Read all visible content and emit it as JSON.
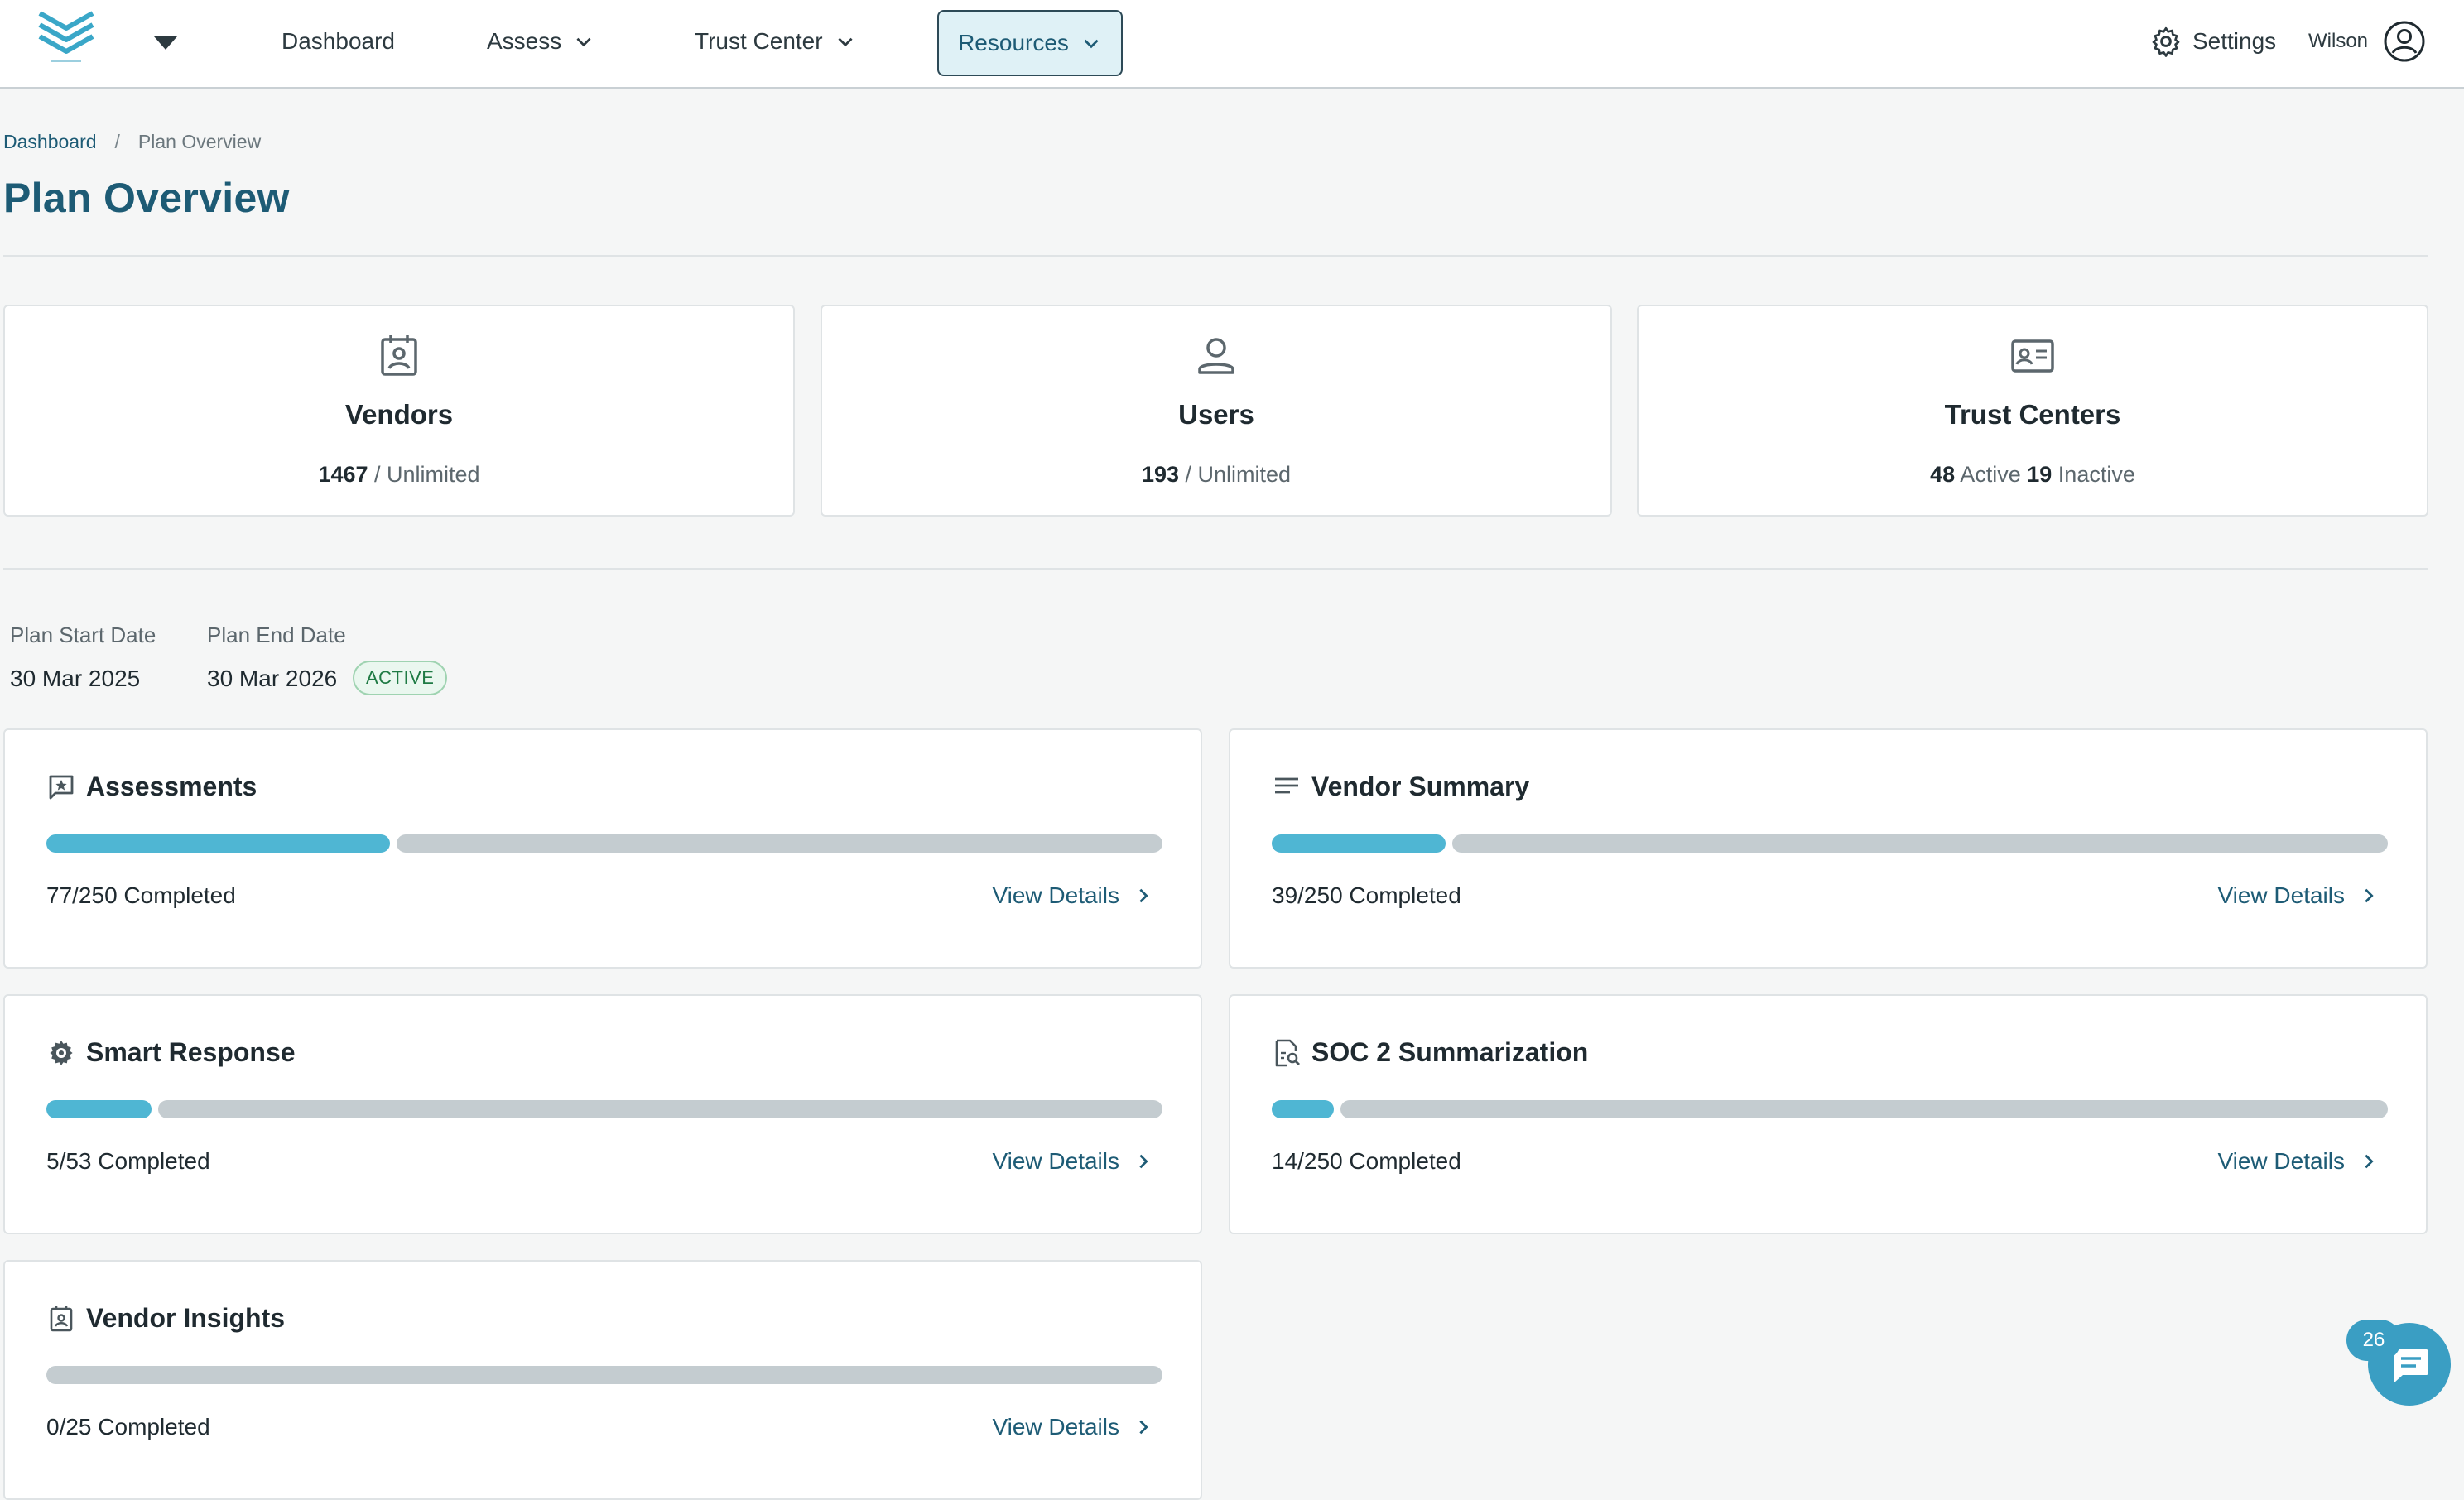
{
  "nav": {
    "items": [
      {
        "label": "Dashboard"
      },
      {
        "label": "Assess"
      },
      {
        "label": "Trust Center"
      },
      {
        "label": "Resources"
      }
    ],
    "settings_label": "Settings",
    "user_name": "Wilson"
  },
  "breadcrumb": {
    "home": "Dashboard",
    "separator": "/",
    "current": "Plan Overview"
  },
  "page_title": "Plan Overview",
  "stats": {
    "vendors": {
      "title": "Vendors",
      "count": "1467",
      "suffix": "/ Unlimited"
    },
    "users": {
      "title": "Users",
      "count": "193",
      "suffix": "/ Unlimited"
    },
    "trust_centers": {
      "title": "Trust Centers",
      "active_count": "48",
      "active_label": "Active",
      "inactive_count": "19",
      "inactive_label": "Inactive"
    }
  },
  "plan": {
    "start_label": "Plan Start Date",
    "start_value": "30 Mar 2025",
    "end_label": "Plan End Date",
    "end_value": "30 Mar 2026",
    "status": "ACTIVE"
  },
  "features": [
    {
      "title": "Assessments",
      "icon": "star-comment-icon",
      "used": 77,
      "total": 250,
      "count_text": "77/250 Completed",
      "link": "View Details"
    },
    {
      "title": "Vendor Summary",
      "icon": "lines-icon",
      "used": 39,
      "total": 250,
      "count_text": "39/250 Completed",
      "link": "View Details"
    },
    {
      "title": "Smart Response",
      "icon": "gear-icon",
      "used": 5,
      "total": 53,
      "count_text": "5/53 Completed",
      "link": "View Details"
    },
    {
      "title": "SOC 2 Summarization",
      "icon": "doc-search-icon",
      "used": 14,
      "total": 250,
      "count_text": "14/250 Completed",
      "link": "View Details"
    },
    {
      "title": "Vendor Insights",
      "icon": "badge-icon",
      "used": 0,
      "total": 25,
      "count_text": "0/25 Completed",
      "link": "View Details"
    }
  ],
  "chat": {
    "badge_count": "26"
  },
  "colors": {
    "accent": "#1d5b75",
    "progress_fill": "#4fb6d3",
    "progress_track": "#c4ccd0",
    "active_badge": "#1f7a44"
  }
}
